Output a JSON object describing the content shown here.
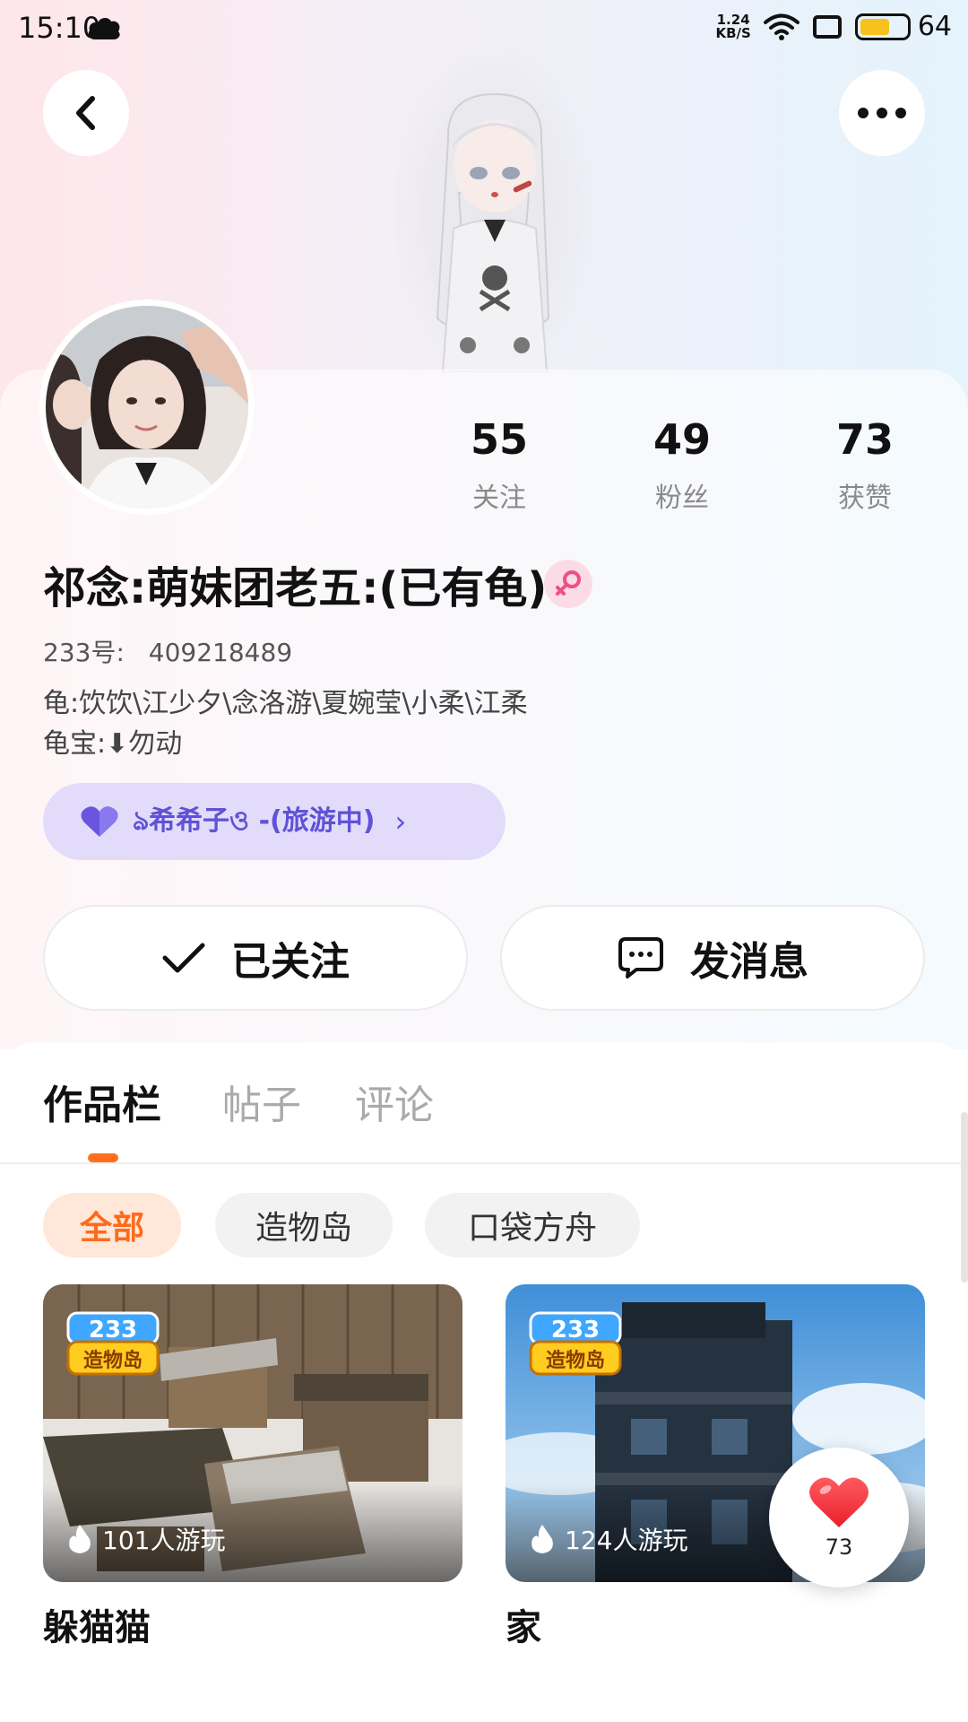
{
  "status_bar": {
    "time": "15:10",
    "net_speed_value": "1.24",
    "net_speed_unit": "KB/S",
    "battery": "64",
    "battery_level": 0.64,
    "battery_color": "#f6c21b"
  },
  "header": {
    "back_icon": "chevron-left-icon",
    "more_icon": "more-dots-icon"
  },
  "profile": {
    "stats": [
      {
        "value": "55",
        "label": "关注"
      },
      {
        "value": "49",
        "label": "粉丝"
      },
      {
        "value": "73",
        "label": "获赞"
      }
    ],
    "nickname": "祁念:萌妹团老五:(已有龟)",
    "gender_icon": "female-icon",
    "uid_label": "233号:",
    "uid_value": "409218489",
    "bio_line1": "龟:饮饮\\江少夕\\念洛游\\夏婉莹\\小柔\\江柔",
    "bio_line2": "龟宝:⬇勿动",
    "team_chip": "ঌ希希子ও -(旅游中)",
    "team_icon": "heart-icon",
    "follow_label": "已关注",
    "message_label": "发消息"
  },
  "tabs": [
    "作品栏",
    "帖子",
    "评论"
  ],
  "filters": [
    "全部",
    "造物岛",
    "口袋方舟"
  ],
  "works": [
    {
      "title": "躲猫猫",
      "plays": "101人游玩",
      "badge_top": "233",
      "badge_bottom": "造物岛"
    },
    {
      "title": "家",
      "plays": "124人游玩",
      "badge_top": "233",
      "badge_bottom": "造物岛"
    }
  ],
  "like_fab": {
    "count": "73",
    "icon": "heart-icon"
  },
  "colors": {
    "accent": "#ff6a1a",
    "team_chip_bg": "#e2dcfa",
    "team_chip_text": "#5f52d6",
    "gender_badge_bg": "#fbdce6"
  }
}
